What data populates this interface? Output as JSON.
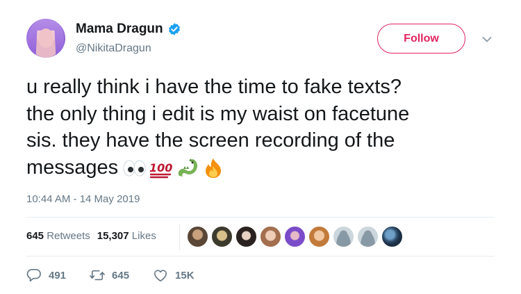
{
  "author": {
    "display_name": "Mama Dragun",
    "handle": "@NikitaDragun",
    "verified": true
  },
  "follow_button": {
    "label": "Follow",
    "accent": "#e0245e"
  },
  "tweet": {
    "lines": [
      "u really think i have the time to fake texts?",
      "the only thing i edit is my waist on facetune",
      "sis. they have the screen recording of the",
      "messages"
    ],
    "emojis": [
      "eyes-emoji",
      "hundred-points-emoji",
      "dragon-emoji",
      "fire-emoji"
    ],
    "timestamp": "10:44 AM - 14 May 2019"
  },
  "stats": {
    "retweets_count": "645",
    "retweets_label": "Retweets",
    "likes_count": "15,307",
    "likes_label": "Likes",
    "liker_avatars": 9
  },
  "actions": {
    "reply_count": "491",
    "retweet_count": "645",
    "like_count": "15K"
  },
  "colors": {
    "text": "#14171a",
    "secondary": "#657786",
    "verified": "#1da1f2",
    "divider": "#e6ecf0"
  }
}
